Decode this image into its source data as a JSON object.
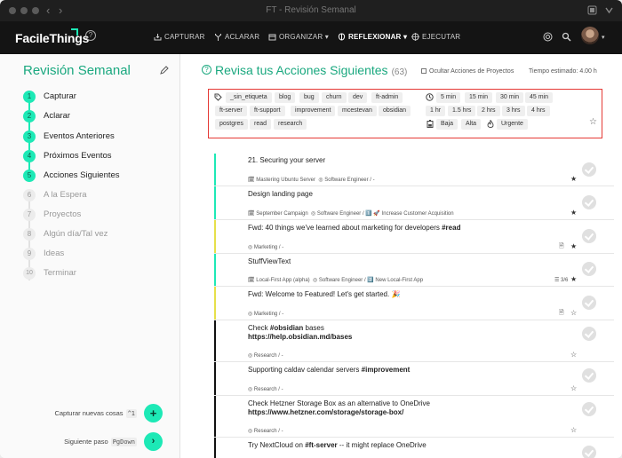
{
  "window": {
    "title": "FT - Revisión Semanal"
  },
  "header": {
    "logo": "FacileThings",
    "nav": [
      {
        "label": "CAPTURAR",
        "icon": "inbox-icon"
      },
      {
        "label": "ACLARAR",
        "icon": "fork-icon"
      },
      {
        "label": "ORGANIZAR",
        "icon": "calendar-icon",
        "caret": "▾"
      },
      {
        "label": "REFLEXIONAR",
        "icon": "brain-icon",
        "caret": "▾",
        "active": true
      },
      {
        "label": "EJECUTAR",
        "icon": "target-icon"
      }
    ],
    "accent": "#1de9b6"
  },
  "sidebar": {
    "title": "Revisión Semanal",
    "steps": [
      {
        "num": "1",
        "label": "Capturar",
        "done": true
      },
      {
        "num": "2",
        "label": "Aclarar",
        "done": true
      },
      {
        "num": "3",
        "label": "Eventos Anteriores",
        "done": true
      },
      {
        "num": "4",
        "label": "Próximos Eventos",
        "done": true
      },
      {
        "num": "5",
        "label": "Acciones Siguientes",
        "done": true
      },
      {
        "num": "6",
        "label": "A la Espera",
        "done": false
      },
      {
        "num": "7",
        "label": "Proyectos",
        "done": false
      },
      {
        "num": "8",
        "label": "Algún día/Tal vez",
        "done": false
      },
      {
        "num": "9",
        "label": "Ideas",
        "done": false
      },
      {
        "num": "10",
        "label": "Terminar",
        "done": false
      }
    ],
    "capture_label": "Capturar nuevas cosas",
    "capture_key": "^1",
    "next_label": "Siguiente paso",
    "next_key": "PgDown"
  },
  "main": {
    "title": "Revisa tus Acciones Siguientes",
    "count": "(63)",
    "hide_link": "Ocultar Acciones de Proyectos",
    "estimate": "Tiempo estimado: 4.00 h",
    "filters": {
      "tags": [
        "_sin_etiqueta",
        "blog",
        "bug",
        "churn",
        "dev",
        "ft-admin",
        "ft-server",
        "ft-support",
        "improvement",
        "mcestevan",
        "obsidian",
        "postgres",
        "read",
        "research"
      ],
      "times": [
        "5 min",
        "15 min",
        "30 min",
        "45 min",
        "1 hr",
        "1.5 hrs",
        "2 hrs",
        "3 hrs",
        "4 hrs"
      ],
      "energy": [
        "Baja",
        "Alta"
      ],
      "priority": [
        "Urgente"
      ]
    },
    "actions": [
      {
        "title": "21. Securing your server",
        "project": "Mastering Ubuntu Server",
        "area": "Software Engineer / -",
        "color": "#1de9b6",
        "star": "★"
      },
      {
        "title": "Design landing page",
        "project": "September Campaign",
        "area": "Software Engineer / 1️⃣ 🚀 Increase Customer Acquisition",
        "color": "#1de9b6",
        "star": "★"
      },
      {
        "title": "Fwd: 40 things we've learned about marketing for developers",
        "tag": "#read",
        "area": "Marketing / -",
        "color": "#e6e04a",
        "star": "★",
        "doc": "🗎"
      },
      {
        "title": "StuffViewText",
        "project": "Local-First App (alpha)",
        "area": "Software Engineer / 2️⃣ New Local-First App",
        "color": "#1de9b6",
        "star": "★",
        "sub": "3/6"
      },
      {
        "title": "Fwd: Welcome to Featured! Let's get started. 🎉",
        "area": "Marketing / -",
        "color": "#e6e04a",
        "star": "☆",
        "doc": "🗎"
      },
      {
        "title": "Check",
        "tag": "#obsidian",
        "title_rest": "bases",
        "link": "https://help.obsidian.md/bases",
        "area": "Research / -",
        "color": "#111111",
        "star": "☆"
      },
      {
        "title": "Supporting caldav calendar servers",
        "tag": "#improvement",
        "area": "Research / -",
        "color": "#111111",
        "star": "☆"
      },
      {
        "title": "Check Hetzner Storage Box as an alternative to OneDrive",
        "link": "https://www.hetzner.com/storage/storage-box/",
        "area": "Research / -",
        "color": "#111111",
        "star": "☆"
      },
      {
        "title": "Try NextCloud on",
        "tag": "#ft-server",
        "title_rest": "-- it might replace OneDrive",
        "color": "#111111"
      }
    ]
  }
}
